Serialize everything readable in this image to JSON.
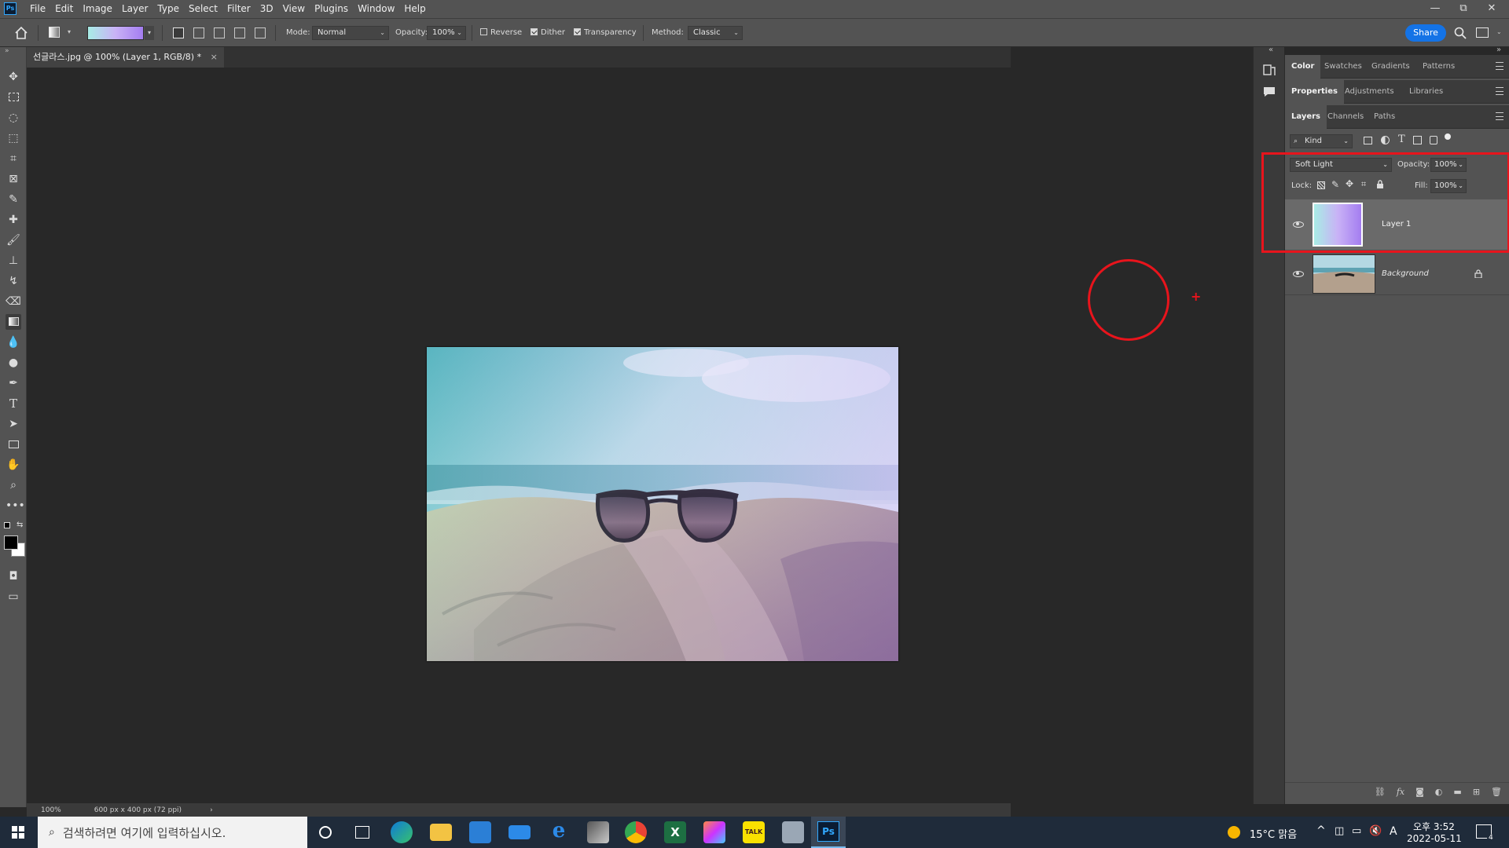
{
  "app": {
    "logo": "Ps",
    "menu": [
      "File",
      "Edit",
      "Image",
      "Layer",
      "Type",
      "Select",
      "Filter",
      "3D",
      "View",
      "Plugins",
      "Window",
      "Help"
    ],
    "window_controls": {
      "minimize": "—",
      "restore": "⧉",
      "close": "✕"
    }
  },
  "options": {
    "mode_label": "Mode:",
    "mode_value": "Normal",
    "opacity_label": "Opacity:",
    "opacity_value": "100%",
    "reverse_label": "Reverse",
    "reverse_checked": false,
    "dither_label": "Dither",
    "dither_checked": true,
    "transparency_label": "Transparency",
    "transparency_checked": true,
    "method_label": "Method:",
    "method_value": "Classic",
    "share_label": "Share",
    "gradient_colors": [
      "#a8ece5",
      "#c9b2f6",
      "#a47df0"
    ]
  },
  "document": {
    "tab_title": "선글라스.jpg @ 100% (Layer 1, RGB/8) *",
    "tab_close": "×"
  },
  "status": {
    "zoom": "100%",
    "doc_info": "600 px x 400 px (72 ppi)",
    "arrow": "›"
  },
  "panels": {
    "top_tabs": [
      "Color",
      "Swatches",
      "Gradients",
      "Patterns"
    ],
    "mid_tabs": [
      "Properties",
      "Adjustments",
      "Libraries"
    ],
    "layer_tabs": [
      "Layers",
      "Channels",
      "Paths"
    ],
    "filter_label": "Kind",
    "blend_mode": "Soft Light",
    "opacity_label": "Opacity:",
    "opacity_value": "100%",
    "lock_label": "Lock:",
    "fill_label": "Fill:",
    "fill_value": "100%",
    "layers": [
      {
        "name": "Layer 1",
        "selected": true,
        "italic": false
      },
      {
        "name": "Background",
        "selected": false,
        "italic": true,
        "locked": true
      }
    ]
  },
  "taskbar": {
    "search_placeholder": "검색하려면 여기에 입력하십시오.",
    "weather": "15°C 맑음",
    "time": "오후 3:52",
    "date": "2022-05-11",
    "ime": "A",
    "notification_count": "4"
  },
  "colors": {
    "accent": "#1473e6",
    "annotation_red": "#e8141c"
  }
}
